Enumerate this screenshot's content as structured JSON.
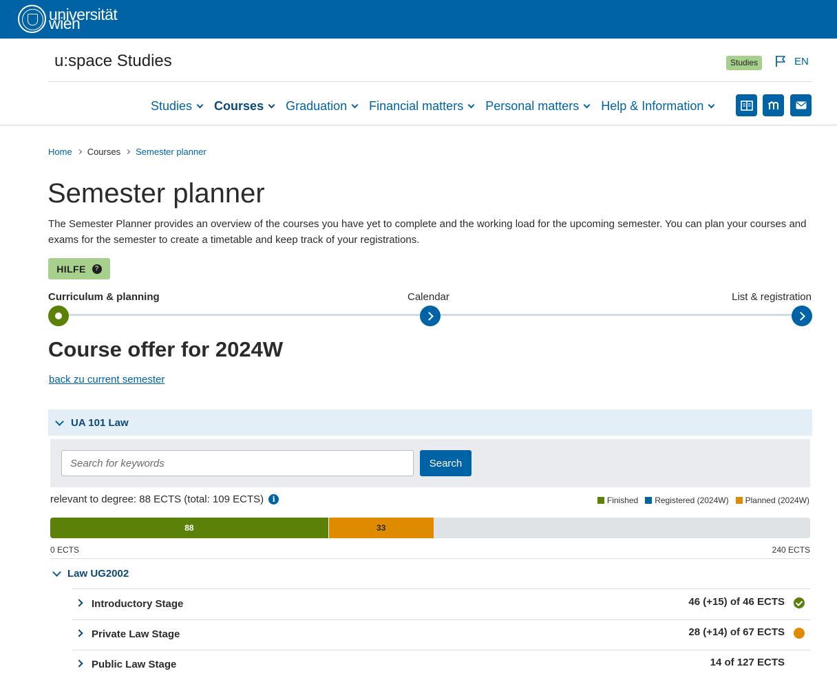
{
  "logo": {
    "line1": "universität",
    "line2": "wien"
  },
  "header": {
    "title": "u:space Studies",
    "badge": "Studies",
    "language": "EN"
  },
  "nav": {
    "items": [
      {
        "label": "Studies",
        "active": false
      },
      {
        "label": "Courses",
        "active": true
      },
      {
        "label": "Graduation",
        "active": false
      },
      {
        "label": "Financial matters",
        "active": false
      },
      {
        "label": "Personal matters",
        "active": false
      },
      {
        "label": "Help & Information",
        "active": false
      }
    ],
    "icons": [
      "book-icon",
      "moodle-icon",
      "mail-icon"
    ]
  },
  "breadcrumb": [
    "Home",
    "Courses",
    "Semester planner"
  ],
  "page": {
    "title": "Semester planner",
    "intro": "The Semester Planner provides an overview of the courses you have yet to complete and the  working load for the upcoming semester. You can plan your courses and exams for the semester to create a timetable and keep track of your registrations.",
    "help_label": "HILFE"
  },
  "steps": [
    "Curriculum & planning",
    "Calendar",
    "List & registration"
  ],
  "offer": {
    "title": "Course offer for 2024W",
    "back_link": "back zu current semester"
  },
  "program": {
    "label": "UA 101 Law",
    "search_placeholder": "Search for keywords",
    "search_value": "",
    "search_button": "Search",
    "relevant": "relevant to degree: 88 ECTS (total: 109 ECTS)",
    "legend": [
      {
        "label": "Finished",
        "color": "#5b8109"
      },
      {
        "label": "Registered (2024W)",
        "color": "#0063a6"
      },
      {
        "label": "Planned (2024W)",
        "color": "#e08a00"
      }
    ],
    "bar": {
      "max": 240,
      "finished": 88,
      "planned": 33,
      "finished_label": "88",
      "planned_label": "33"
    },
    "axis_min": "0 ECTS",
    "axis_max": "240 ECTS",
    "curriculum": "Law UG2002",
    "stages": [
      {
        "name": "Introductory Stage",
        "value": "46 (+15) of 46 ECTS",
        "status": "done"
      },
      {
        "name": "Private Law Stage",
        "value": "28 (+14) of 67 ECTS",
        "status": "planned"
      },
      {
        "name": "Public Law Stage",
        "value": "14 of 127 ECTS",
        "status": "none"
      }
    ]
  },
  "colors": {
    "brand": "#0063a6",
    "finished": "#5b8109",
    "planned": "#e08a00",
    "badge": "#a8d08d"
  }
}
